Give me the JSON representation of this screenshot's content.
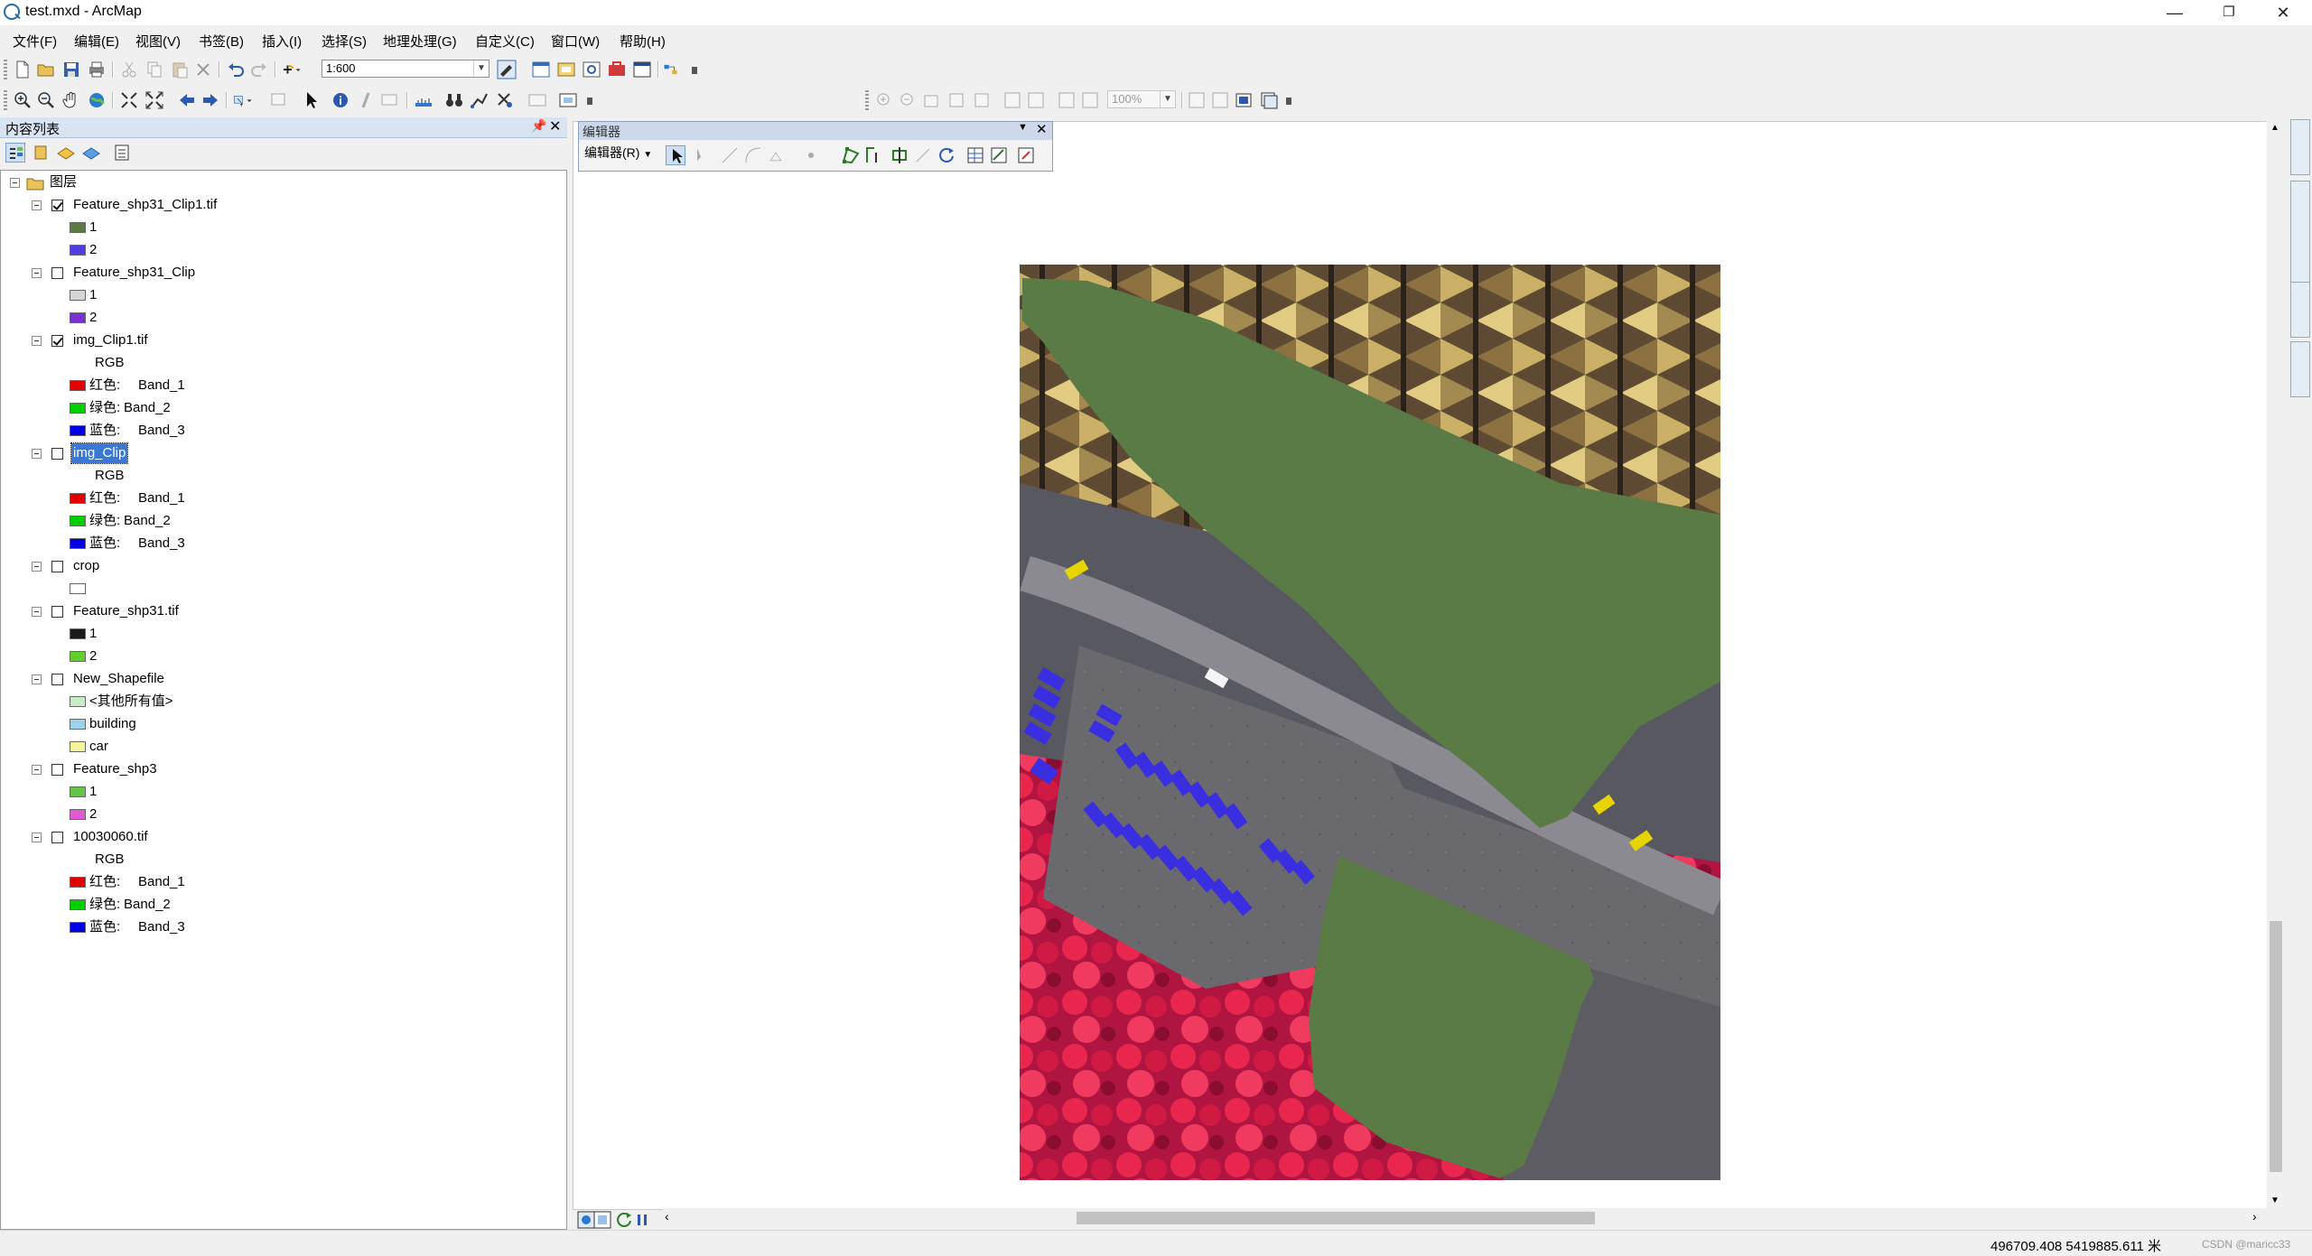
{
  "window": {
    "title": "test.mxd - ArcMap"
  },
  "menu": [
    "文件(F)",
    "编辑(E)",
    "视图(V)",
    "书签(B)",
    "插入(I)",
    "选择(S)",
    "地理处理(G)",
    "自定义(C)",
    "窗口(W)",
    "帮助(H)"
  ],
  "toolbar": {
    "scale": "1:600",
    "zoom": "100%"
  },
  "toc": {
    "title": "内容列表",
    "root": "图层",
    "layers": [
      {
        "name": "Feature_shp31_Clip1.tif",
        "checked": true,
        "items": [
          {
            "label": "1",
            "color": "#5b7a44"
          },
          {
            "label": "2",
            "color": "#4f3fe0"
          }
        ]
      },
      {
        "name": "Feature_shp31_Clip",
        "checked": false,
        "items": [
          {
            "label": "1",
            "color": "#d6d6d6"
          },
          {
            "label": "2",
            "color": "#7a2fd0"
          }
        ]
      },
      {
        "name": "img_Clip1.tif",
        "checked": true,
        "rgb": "RGB",
        "bands": [
          {
            "label": "红色:",
            "band": "Band_1",
            "color": "#e00000"
          },
          {
            "label": "绿色:",
            "band": "Band_2",
            "color": "#00d000"
          },
          {
            "label": "蓝色:",
            "band": "Band_3",
            "color": "#0000e0"
          }
        ]
      },
      {
        "name": "img_Clip",
        "checked": false,
        "selected": true,
        "rgb": "RGB",
        "bands": [
          {
            "label": "红色:",
            "band": "Band_1",
            "color": "#e00000"
          },
          {
            "label": "绿色:",
            "band": "Band_2",
            "color": "#00d000"
          },
          {
            "label": "蓝色:",
            "band": "Band_3",
            "color": "#0000e0"
          }
        ]
      },
      {
        "name": "crop",
        "checked": false,
        "items": [
          {
            "label": "",
            "color": "#ffffff"
          }
        ]
      },
      {
        "name": "Feature_shp31.tif",
        "checked": false,
        "items": [
          {
            "label": "1",
            "color": "#1a1a1a"
          },
          {
            "label": "2",
            "color": "#5fd02a"
          }
        ]
      },
      {
        "name": "New_Shapefile",
        "checked": false,
        "items": [
          {
            "label": "<其他所有值>",
            "color": "#c8ecc8"
          },
          {
            "label": "building",
            "color": "#9ad4ec"
          },
          {
            "label": "car",
            "color": "#f4f49a"
          }
        ]
      },
      {
        "name": "Feature_shp3",
        "checked": false,
        "items": [
          {
            "label": "1",
            "color": "#64c446"
          },
          {
            "label": "2",
            "color": "#e05ad2"
          }
        ]
      },
      {
        "name": "10030060.tif",
        "checked": false,
        "rgb": "RGB",
        "bands": [
          {
            "label": "红色:",
            "band": "Band_1",
            "color": "#e00000"
          },
          {
            "label": "绿色:",
            "band": "Band_2",
            "color": "#00d000"
          },
          {
            "label": "蓝色:",
            "band": "Band_3",
            "color": "#0000e0"
          }
        ]
      }
    ]
  },
  "editor": {
    "title": "编辑器",
    "menu": "编辑器(R)"
  },
  "status": {
    "coordinates": "496709.408  5419885.611 米",
    "watermark": "CSDN @maricc33"
  },
  "colors": {
    "polygon": "#5a7a46",
    "car_blue": "#3a2fe0",
    "vegetation": "#d01a4a"
  }
}
